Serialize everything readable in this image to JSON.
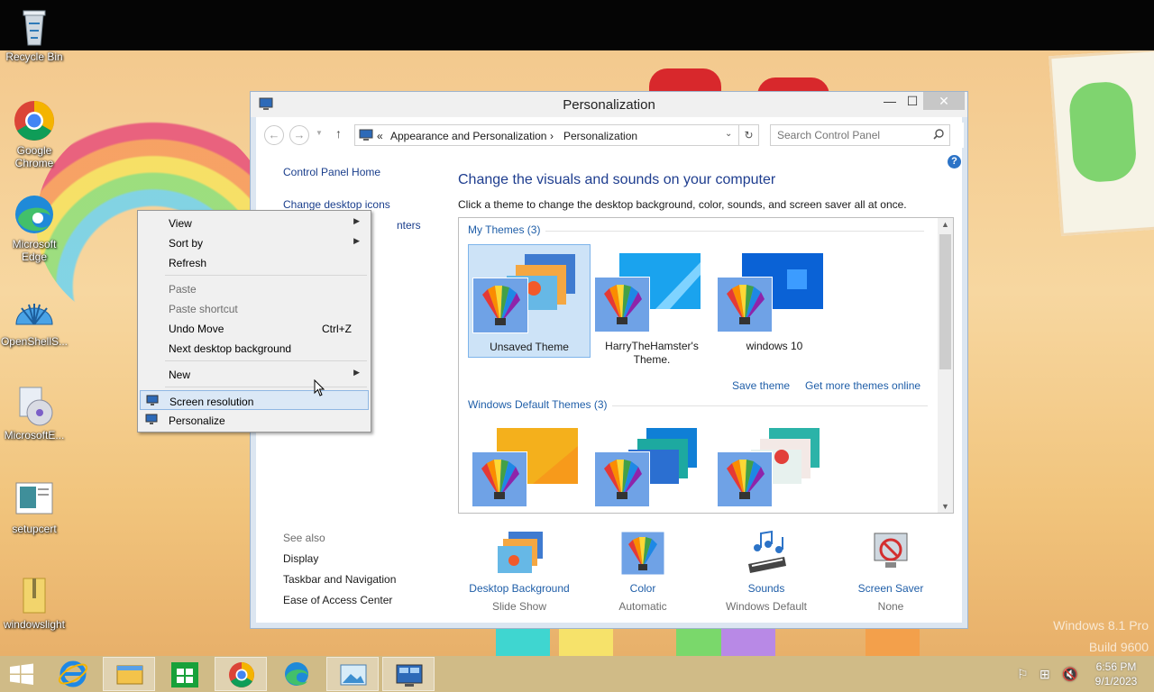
{
  "desktop": {
    "icons": [
      {
        "label": "Recycle Bin",
        "icon": "recycle-bin-icon"
      },
      {
        "label": "Google Chrome",
        "icon": "chrome-icon"
      },
      {
        "label": "Microsoft Edge",
        "icon": "edge-icon"
      },
      {
        "label": "OpenShellS...",
        "icon": "shell-icon"
      },
      {
        "label": "MicrosoftE...",
        "icon": "installer-icon"
      },
      {
        "label": "setupcert",
        "icon": "file-icon"
      },
      {
        "label": "windowslight",
        "icon": "zip-folder-icon"
      }
    ],
    "watermark": {
      "line1": "Windows 8.1 Pro",
      "line2": "Build 9600"
    }
  },
  "window": {
    "title": "Personalization",
    "controls": {
      "minimize": "—",
      "maximize": "☐",
      "close": "✕"
    },
    "address": {
      "prefix": "«",
      "crumb1": "Appearance and Personalization",
      "sep": "›",
      "crumb2": "Personalization"
    },
    "search_placeholder": "Search Control Panel",
    "left_nav": {
      "home": "Control Panel Home",
      "desktop_icons": "Change desktop icons",
      "mouse_pointers": "nters",
      "see_also": "See also",
      "links": [
        "Display",
        "Taskbar and Navigation",
        "Ease of Access Center"
      ]
    },
    "heading": "Change the visuals and sounds on your computer",
    "subheading": "Click a theme to change the desktop background, color, sounds, and screen saver all at once.",
    "my_themes": {
      "group_label": "My Themes (3)",
      "items": [
        {
          "name": "Unsaved Theme",
          "selected": true
        },
        {
          "name": "HarryTheHamster's Theme.",
          "selected": false
        },
        {
          "name": "windows 10",
          "selected": false
        }
      ],
      "save_theme": "Save theme",
      "get_more": "Get more themes online"
    },
    "default_themes": {
      "group_label": "Windows Default Themes (3)"
    },
    "bottom": [
      {
        "label": "Desktop Background",
        "sub": "Slide Show",
        "icon": "desktop-background-icon"
      },
      {
        "label": "Color",
        "sub": "Automatic",
        "icon": "color-palette-icon"
      },
      {
        "label": "Sounds",
        "sub": "Windows Default",
        "icon": "sounds-icon"
      },
      {
        "label": "Screen Saver",
        "sub": "None",
        "icon": "screen-saver-icon"
      }
    ]
  },
  "context_menu": {
    "items": [
      {
        "label": "View",
        "submenu": true
      },
      {
        "label": "Sort by",
        "submenu": true
      },
      {
        "label": "Refresh"
      },
      {
        "label": "Paste",
        "disabled": true
      },
      {
        "label": "Paste shortcut",
        "disabled": true
      },
      {
        "label": "Undo Move",
        "accel": "Ctrl+Z"
      },
      {
        "label": "Next desktop background"
      },
      {
        "label": "New",
        "submenu": true
      },
      {
        "label": "Screen resolution",
        "highlighted": true
      },
      {
        "label": "Personalize"
      }
    ]
  },
  "taskbar": {
    "apps": [
      "start-icon",
      "internet-explorer-icon",
      "file-explorer-icon",
      "store-icon",
      "chrome-icon",
      "edge-icon",
      "photos-icon",
      "control-panel-icon"
    ],
    "clock": {
      "time": "6:56 PM",
      "date": "9/1/2023"
    }
  },
  "colors": {
    "accent": "#1f5ea8",
    "heading": "#1e3d8f",
    "selection": "#cde3f7"
  }
}
